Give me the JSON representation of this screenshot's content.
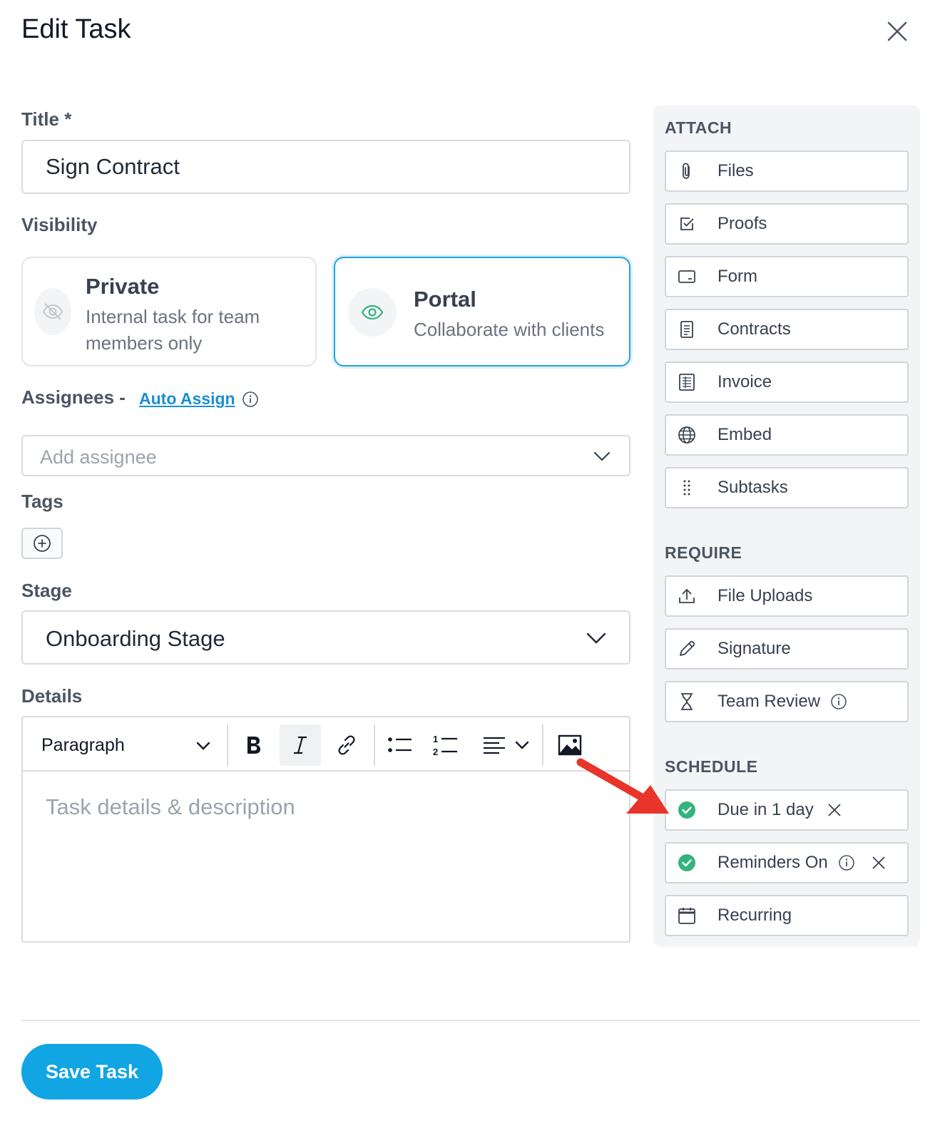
{
  "modal": {
    "title": "Edit Task"
  },
  "form": {
    "title_label": "Title *",
    "title_value": "Sign Contract",
    "visibility_label": "Visibility",
    "visibility": {
      "private": {
        "title": "Private",
        "desc_line1": "Internal task for team",
        "desc_line2": "members only",
        "icon": "eye-off-icon"
      },
      "portal": {
        "title": "Portal",
        "desc": "Collaborate with clients",
        "icon": "eye-icon",
        "selected": true
      }
    },
    "assignees_label": "Assignees -",
    "auto_assign": "Auto Assign",
    "assignee_placeholder": "Add assignee",
    "tags_label": "Tags",
    "stage_label": "Stage",
    "stage_value": "Onboarding Stage",
    "details_label": "Details",
    "editor": {
      "block_format": "Paragraph",
      "placeholder": "Task details & description"
    }
  },
  "sidebar": {
    "attach_heading": "ATTACH",
    "attach_items": [
      {
        "label": "Files",
        "icon": "paperclip-icon"
      },
      {
        "label": "Proofs",
        "icon": "checkbox-icon"
      },
      {
        "label": "Form",
        "icon": "form-icon"
      },
      {
        "label": "Contracts",
        "icon": "document-icon"
      },
      {
        "label": "Invoice",
        "icon": "invoice-icon"
      },
      {
        "label": "Embed",
        "icon": "globe-icon"
      },
      {
        "label": "Subtasks",
        "icon": "dots-vertical-icon"
      }
    ],
    "require_heading": "REQUIRE",
    "require_items": [
      {
        "label": "File Uploads",
        "icon": "upload-icon"
      },
      {
        "label": "Signature",
        "icon": "pen-icon"
      },
      {
        "label": "Team Review",
        "icon": "hourglass-icon"
      }
    ],
    "schedule_heading": "SCHEDULE",
    "schedule_items": [
      {
        "label": "Due in 1 day",
        "icon": "check-circle-icon",
        "active": true
      },
      {
        "label": "Reminders On",
        "icon": "check-circle-icon",
        "active": true
      },
      {
        "label": "Recurring",
        "icon": "calendar-icon",
        "active": false
      }
    ]
  },
  "footer": {
    "save_label": "Save Task"
  },
  "colors": {
    "accent": "#12a5e4",
    "link": "#1a8fd3",
    "success": "#34b37e",
    "annotation_arrow": "#e8342a"
  }
}
